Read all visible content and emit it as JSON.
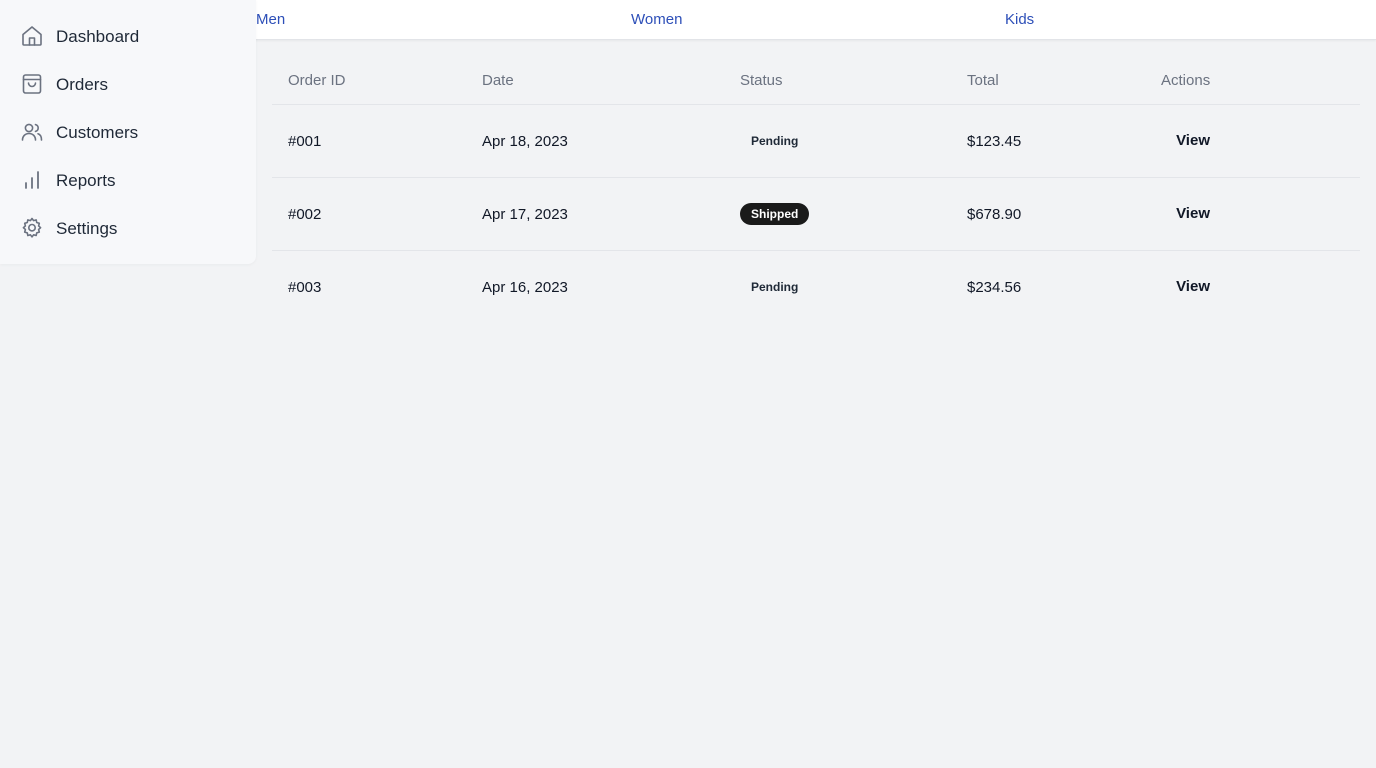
{
  "topnav": {
    "links": [
      {
        "label": "Men"
      },
      {
        "label": "Women"
      },
      {
        "label": "Kids"
      }
    ],
    "link_color": "#2d4fb8"
  },
  "sidebar": {
    "items": [
      {
        "label": "Dashboard",
        "icon": "home-icon"
      },
      {
        "label": "Orders",
        "icon": "shopping-bag-icon"
      },
      {
        "label": "Customers",
        "icon": "users-icon"
      },
      {
        "label": "Reports",
        "icon": "bar-chart-icon"
      },
      {
        "label": "Settings",
        "icon": "gear-icon"
      }
    ]
  },
  "table": {
    "headers": [
      "Order ID",
      "Date",
      "Status",
      "Total",
      "Actions"
    ],
    "rows": [
      {
        "id": "#001",
        "date": "Apr 18, 2023",
        "status": "Pending",
        "total": "$123.45",
        "action": "View"
      },
      {
        "id": "#002",
        "date": "Apr 17, 2023",
        "status": "Shipped",
        "total": "$678.90",
        "action": "View"
      },
      {
        "id": "#003",
        "date": "Apr 16, 2023",
        "status": "Pending",
        "total": "$234.56",
        "action": "View"
      }
    ]
  },
  "colors": {
    "background": "#f2f3f5",
    "shipped_badge": "#1a1a1a"
  }
}
